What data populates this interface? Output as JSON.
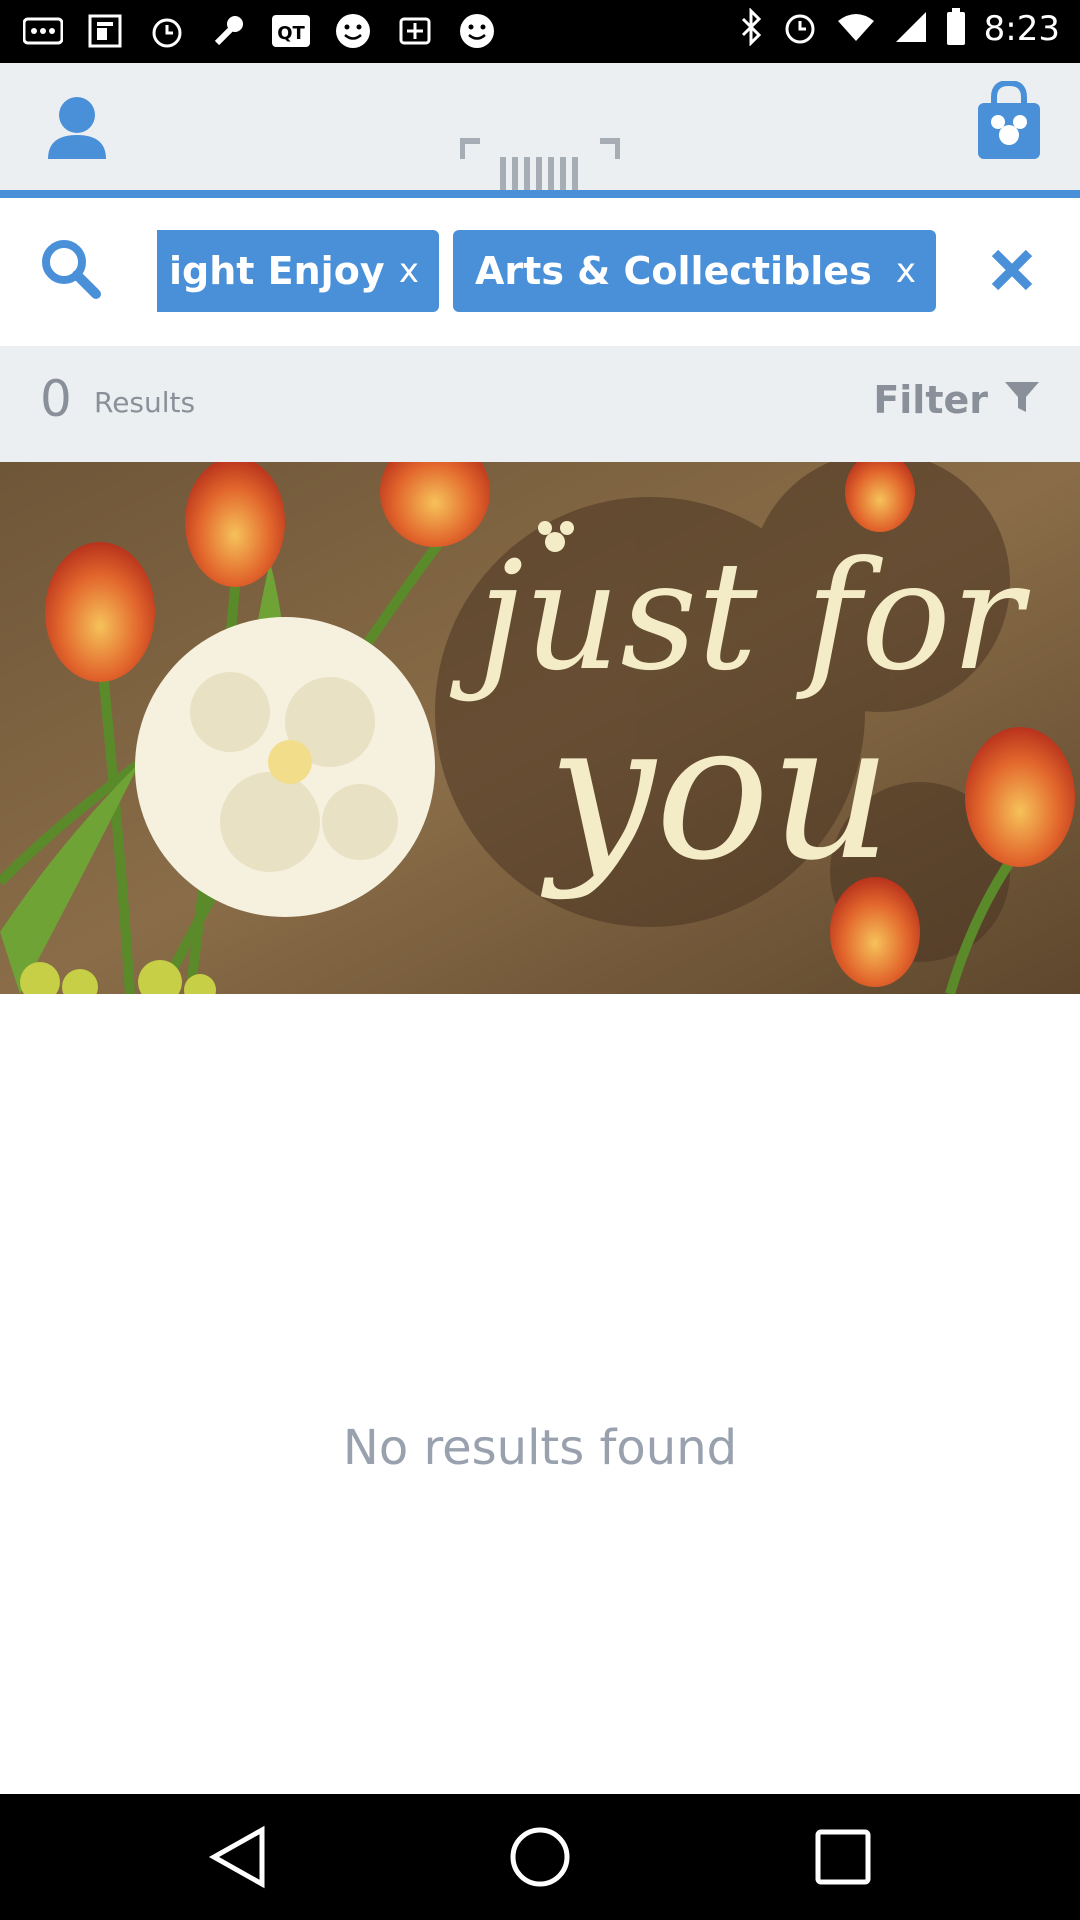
{
  "status_bar": {
    "time": "8:23",
    "icons": [
      "more-icon",
      "notification-icon",
      "alarm-icon",
      "wrench-icon",
      "qt-icon",
      "smiley-icon",
      "app-icon",
      "smiley-icon",
      "bluetooth-icon",
      "alarm-icon",
      "wifi-icon",
      "signal-icon",
      "battery-icon"
    ]
  },
  "app_bar": {
    "user_icon": "user-icon",
    "scan_icon": "barcode-scan-icon",
    "bag_icon": "shopping-bag-icon"
  },
  "search_row": {
    "chips": [
      {
        "label": "ight Enjoy",
        "close": "x"
      },
      {
        "label": "Arts & Collectibles",
        "close": "x"
      }
    ]
  },
  "results_bar": {
    "count": "0",
    "label": "Results",
    "filter_label": "Filter"
  },
  "banner": {
    "line1": "just for",
    "line2": "you"
  },
  "empty_state": {
    "message": "No results found"
  },
  "colors": {
    "accent": "#4a90d9",
    "bar_bg": "#eceff2",
    "muted_text": "#8a9099"
  }
}
